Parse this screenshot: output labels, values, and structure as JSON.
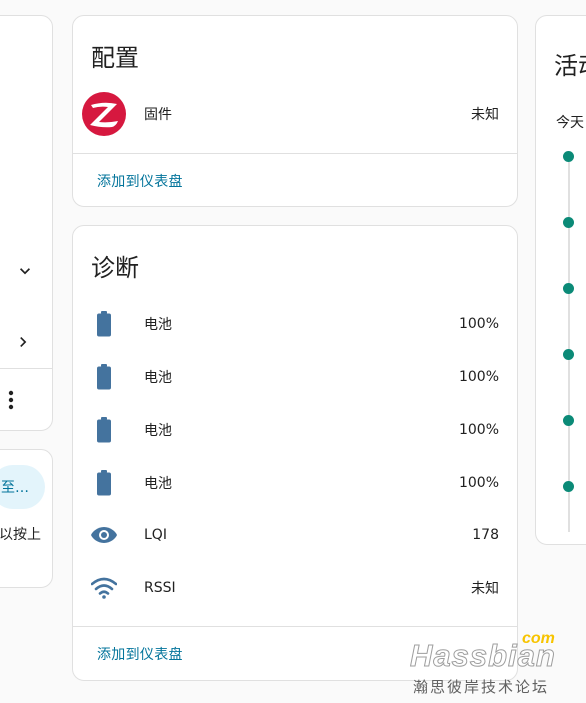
{
  "left_card": {
    "chevron_down": "expand",
    "chevron_right": "open",
    "more": "more-options"
  },
  "left_card2": {
    "pill_text": "至…",
    "text": "以按上"
  },
  "config_card": {
    "title": "配置",
    "rows": [
      {
        "icon": "zigbee-logo",
        "label": "固件",
        "value": "未知"
      }
    ],
    "add_link": "添加到仪表盘"
  },
  "diag_card": {
    "title": "诊断",
    "rows": [
      {
        "icon": "battery-icon",
        "label": "电池",
        "value": "100%"
      },
      {
        "icon": "battery-icon",
        "label": "电池",
        "value": "100%"
      },
      {
        "icon": "battery-icon",
        "label": "电池",
        "value": "100%"
      },
      {
        "icon": "battery-icon",
        "label": "电池",
        "value": "100%"
      },
      {
        "icon": "eye-icon",
        "label": "LQI",
        "value": "178"
      },
      {
        "icon": "wifi-icon",
        "label": "RSSI",
        "value": "未知"
      }
    ],
    "add_link": "添加到仪表盘"
  },
  "activity_card": {
    "title": "活动",
    "today": "今天"
  },
  "watermark": {
    "brand": "Hassbian",
    "com": "com",
    "subtitle": "瀚思彼岸技术论坛"
  },
  "colors": {
    "accent_link": "#03749b",
    "icon_blue": "#44739e",
    "timeline_green": "#0b8a77",
    "zigbee_red": "#d6183f"
  }
}
